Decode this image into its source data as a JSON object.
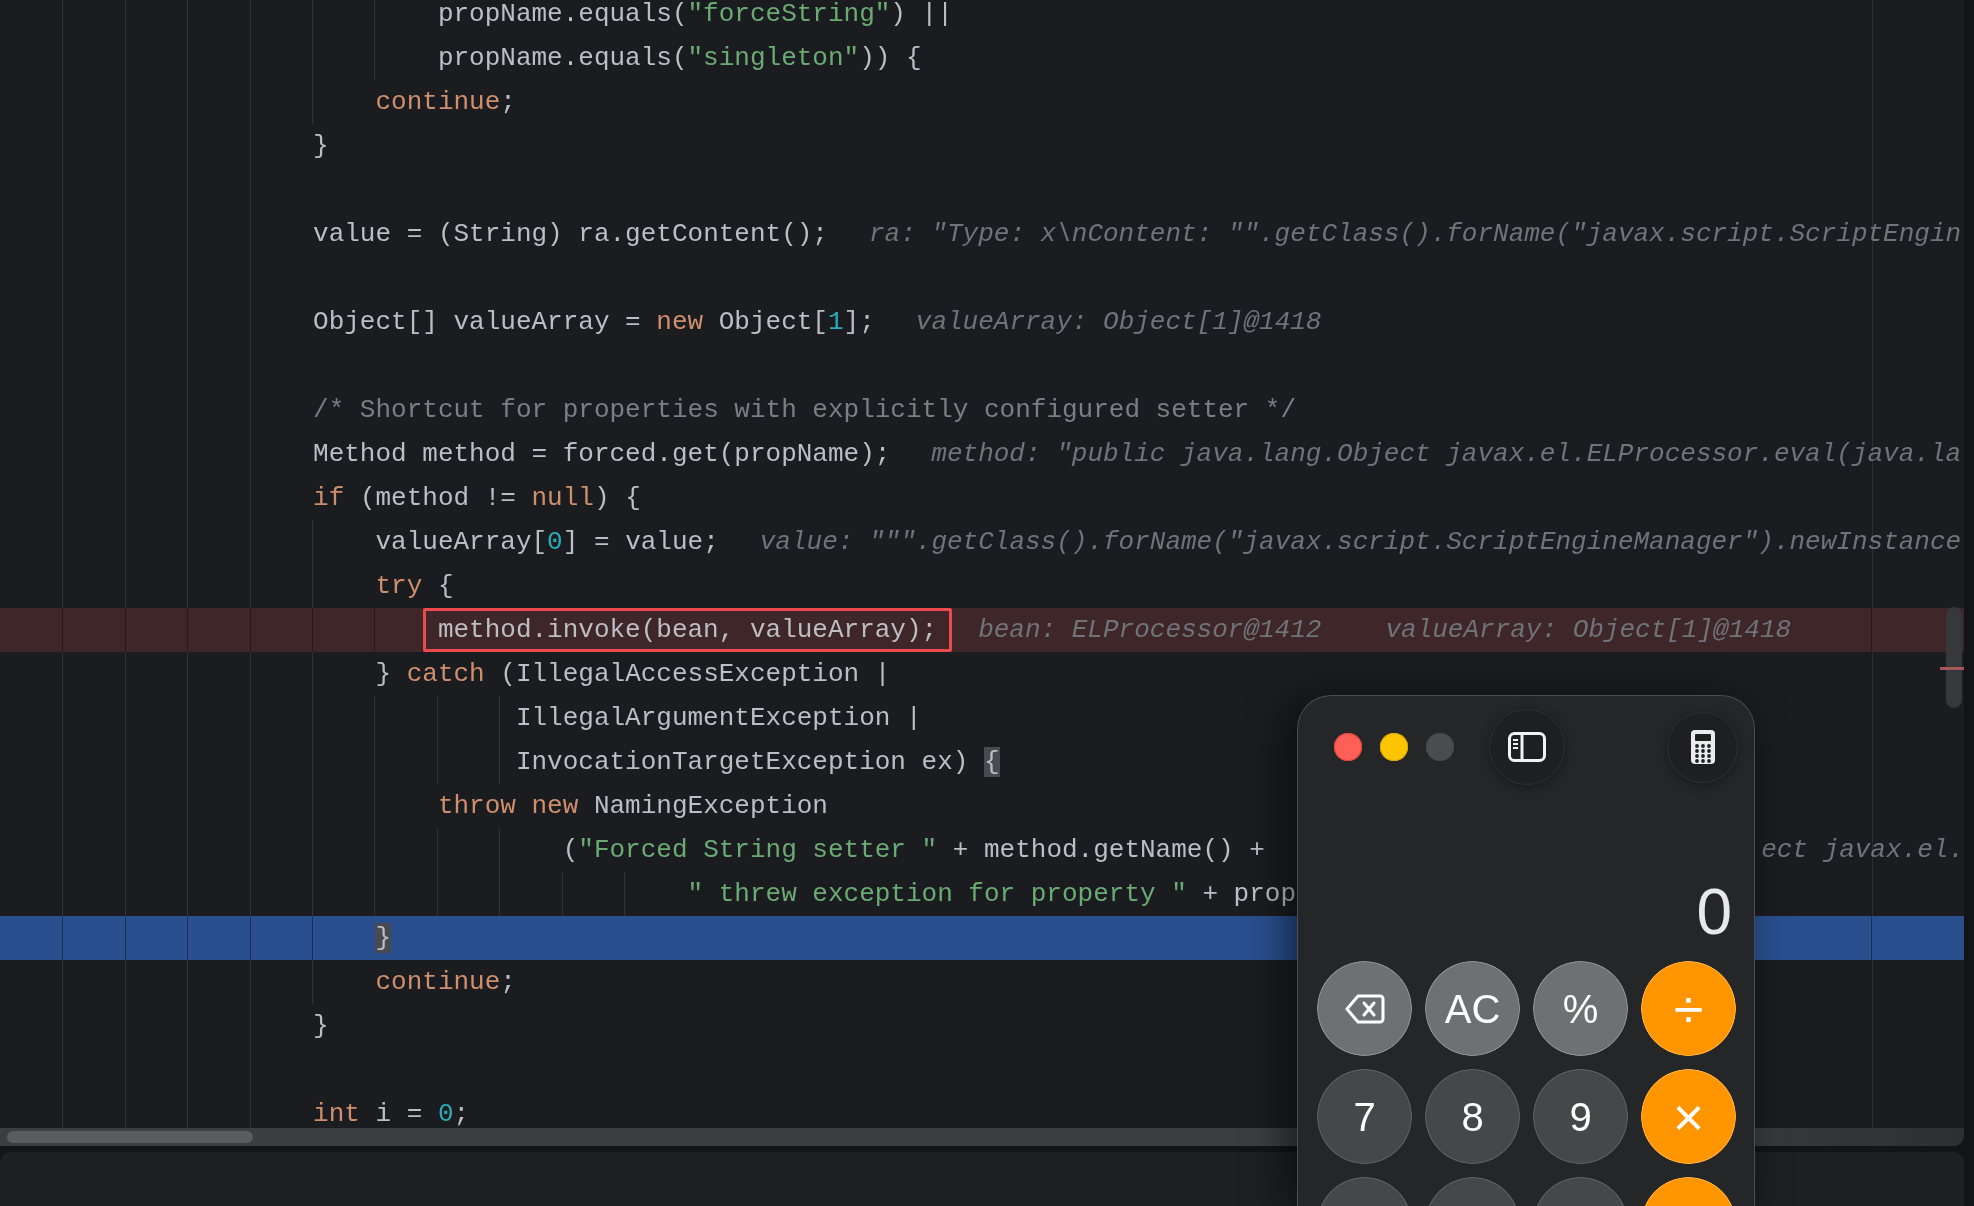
{
  "editor": {
    "lines": [
      {
        "kind": "code",
        "tokens": [
          {
            "kind": "plain",
            "text": "                            propName.equals("
          },
          {
            "kind": "string",
            "text": "\"forceString\""
          },
          {
            "kind": "plain",
            "text": ") ||"
          }
        ]
      },
      {
        "kind": "code",
        "tokens": [
          {
            "kind": "plain",
            "text": "                            propName.equals("
          },
          {
            "kind": "string",
            "text": "\"singleton\""
          },
          {
            "kind": "plain",
            "text": ")) {"
          }
        ]
      },
      {
        "kind": "code",
        "tokens": [
          {
            "kind": "keyword",
            "text": "                        continue"
          },
          {
            "kind": "plain",
            "text": ";"
          }
        ]
      },
      {
        "kind": "code",
        "tokens": [
          {
            "kind": "plain",
            "text": "                    }"
          }
        ]
      },
      {
        "kind": "blank"
      },
      {
        "kind": "code",
        "tokens": [
          {
            "kind": "plain",
            "text": "                    value = (String) ra.getContent();"
          }
        ],
        "hints": [
          {
            "kind": "inline",
            "text": "ra: \"Type: x\\nContent: \"\".getClass().forName(\"javax.script.ScriptEngin"
          }
        ]
      },
      {
        "kind": "blank"
      },
      {
        "kind": "code",
        "tokens": [
          {
            "kind": "plain",
            "text": "                    Object[] valueArray = "
          },
          {
            "kind": "keyword",
            "text": "new"
          },
          {
            "kind": "plain",
            "text": " Object["
          },
          {
            "kind": "number",
            "text": "1"
          },
          {
            "kind": "plain",
            "text": "];"
          }
        ],
        "hints": [
          {
            "kind": "inline",
            "text": "valueArray: Object[1]@1418"
          }
        ]
      },
      {
        "kind": "blank"
      },
      {
        "kind": "code",
        "tokens": [
          {
            "kind": "comment",
            "text": "                    /* Shortcut for properties with explicitly configured setter */"
          }
        ]
      },
      {
        "kind": "code",
        "tokens": [
          {
            "kind": "plain",
            "text": "                    Method method = forced.get(propName);"
          }
        ],
        "hints": [
          {
            "kind": "inline",
            "text": "method: \"public java.lang.Object javax.el.ELProcessor.eval(java.la"
          }
        ]
      },
      {
        "kind": "code",
        "tokens": [
          {
            "kind": "keyword",
            "text": "                    if"
          },
          {
            "kind": "plain",
            "text": " (method != "
          },
          {
            "kind": "keyword",
            "text": "null"
          },
          {
            "kind": "plain",
            "text": ") {"
          }
        ]
      },
      {
        "kind": "code",
        "tokens": [
          {
            "kind": "plain",
            "text": "                        valueArray["
          },
          {
            "kind": "number",
            "text": "0"
          },
          {
            "kind": "plain",
            "text": "] = value;"
          }
        ],
        "hints": [
          {
            "kind": "inline",
            "text": "value: \"\"\".getClass().forName(\"javax.script.ScriptEngineManager\").newInstance"
          }
        ]
      },
      {
        "kind": "code",
        "tokens": [
          {
            "kind": "keyword",
            "text": "                        try"
          },
          {
            "kind": "plain",
            "text": " {"
          }
        ]
      },
      {
        "kind": "breakpoint",
        "tokens": [
          {
            "kind": "plain",
            "text": "                            method.invoke(bean, valueArray);"
          }
        ],
        "hints": [
          {
            "kind": "inline",
            "text": "bean: ELProcessor@1412"
          },
          {
            "kind": "inline",
            "text": "valueArray: Object[1]@1418"
          }
        ]
      },
      {
        "kind": "code",
        "tokens": [
          {
            "kind": "plain",
            "text": "                        } "
          },
          {
            "kind": "keyword",
            "text": "catch"
          },
          {
            "kind": "plain",
            "text": " (IllegalAccessException |"
          }
        ]
      },
      {
        "kind": "code",
        "tokens": [
          {
            "kind": "plain",
            "text": "                                 IllegalArgumentException |"
          }
        ]
      },
      {
        "kind": "code",
        "tokens": [
          {
            "kind": "plain",
            "text": "                                 InvocationTargetException ex) "
          },
          {
            "kind": "brace",
            "text": "{"
          }
        ]
      },
      {
        "kind": "code",
        "tokens": [
          {
            "kind": "keyword",
            "text": "                            throw new"
          },
          {
            "kind": "plain",
            "text": " NamingException"
          }
        ]
      },
      {
        "kind": "code",
        "tokens": [
          {
            "kind": "plain",
            "text": "                                    ("
          },
          {
            "kind": "string",
            "text": "\"Forced String setter \""
          },
          {
            "kind": "plain",
            "text": " + method.getName() +"
          }
        ],
        "hints": [
          {
            "kind": "tail",
            "text": "ect javax.el."
          }
        ]
      },
      {
        "kind": "code",
        "tokens": [
          {
            "kind": "string",
            "text": "                                            \" threw exception for property \""
          },
          {
            "kind": "plain",
            "text": " + prop"
          }
        ]
      },
      {
        "kind": "execution",
        "tokens": [
          {
            "kind": "brace",
            "text": "                        }"
          }
        ]
      },
      {
        "kind": "code",
        "tokens": [
          {
            "kind": "keyword",
            "text": "                        continue"
          },
          {
            "kind": "plain",
            "text": ";"
          }
        ]
      },
      {
        "kind": "code",
        "tokens": [
          {
            "kind": "plain",
            "text": "                    }"
          }
        ]
      },
      {
        "kind": "blank"
      },
      {
        "kind": "code",
        "tokens": [
          {
            "kind": "keyword",
            "text": "                    int"
          },
          {
            "kind": "plain",
            "text": " i = "
          },
          {
            "kind": "number",
            "text": "0"
          },
          {
            "kind": "plain",
            "text": ";"
          }
        ]
      }
    ]
  },
  "calculator": {
    "window_controls": [
      {
        "kind": "close",
        "disabled": false
      },
      {
        "kind": "minimize",
        "disabled": false
      },
      {
        "kind": "zoom",
        "disabled": true
      }
    ],
    "display": "0",
    "keys": [
      {
        "kind": "backspace"
      },
      {
        "kind": "function",
        "label": "AC"
      },
      {
        "kind": "function",
        "label": "%"
      },
      {
        "kind": "operator",
        "label": "÷"
      },
      {
        "kind": "digit",
        "label": "7"
      },
      {
        "kind": "digit",
        "label": "8"
      },
      {
        "kind": "digit",
        "label": "9"
      },
      {
        "kind": "operator",
        "label": "×"
      },
      {
        "kind": "digit"
      },
      {
        "kind": "digit"
      },
      {
        "kind": "digit"
      },
      {
        "kind": "operator"
      }
    ]
  }
}
